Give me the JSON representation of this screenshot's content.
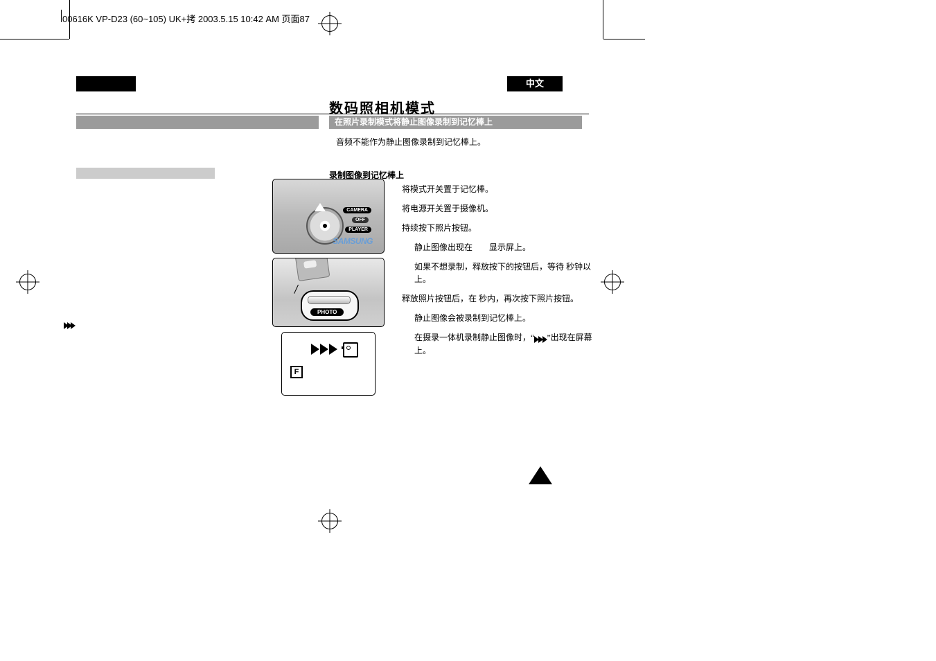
{
  "meta": {
    "jobline": "00616K VP-D23 (60~105) UK+拷 2003.5.15 10:42 AM 页面87"
  },
  "lang_tab": "中文",
  "title": "数码照相机模式",
  "section_bar": "在照片录制模式将静止图像录制到记忆棒上",
  "note": "音频不能作为静止图像录制到记忆棒上。",
  "subhead": "录制图像到记忆棒上",
  "steps": {
    "s1": "将模式开关置于记忆棒。",
    "s2": "将电源开关置于摄像机。",
    "s3": "持续按下照片按钮。",
    "s3a": "静止图像出现在　　显示屏上。",
    "s3b": "如果不想录制，释放按下的按钮后，等待 秒钟以上。",
    "s4": "释放照片按钮后，在 秒内，再次按下照片按钮。",
    "s4a": "静止图像会被录制到记忆棒上。",
    "s4b_pre": "在摄录一体机录制静止图像时，“",
    "s4b_post": "”出现在屏幕上。"
  },
  "fig1": {
    "label_camera": "CAMERA",
    "label_off": "OFF",
    "label_player": "PLAYER",
    "brand": "SAMSUNG"
  },
  "fig2": {
    "label_photo": "PHOTO"
  },
  "fig3": {
    "f_letter": "F"
  }
}
